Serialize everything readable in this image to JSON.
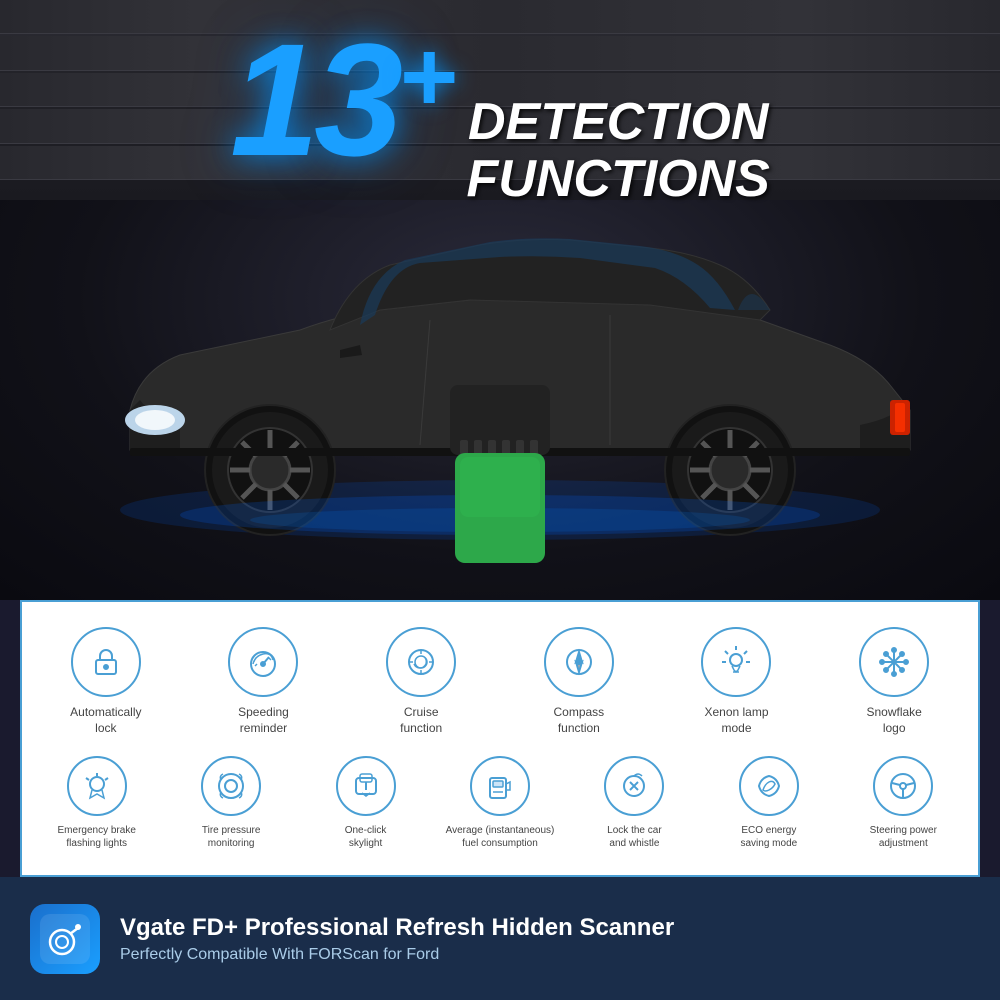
{
  "header": {
    "number": "13",
    "plus": "+",
    "line1": "DETECTION",
    "line2": "FUNCTIONS"
  },
  "features": {
    "row1": [
      {
        "id": "auto-lock",
        "icon": "lock",
        "label": "Automatically\nlock"
      },
      {
        "id": "speeding",
        "icon": "speedometer",
        "label": "Speeding\nreminder"
      },
      {
        "id": "cruise",
        "icon": "cruise",
        "label": "Cruise\nfunction"
      },
      {
        "id": "compass",
        "icon": "compass",
        "label": "Compass\nfunction"
      },
      {
        "id": "xenon",
        "icon": "bulb",
        "label": "Xenon lamp\nmode"
      },
      {
        "id": "snowflake",
        "icon": "snowflake",
        "label": "Snowflake\nlogo"
      }
    ],
    "row2": [
      {
        "id": "emergency",
        "icon": "flash",
        "label": "Emergency brake\nflashing lights"
      },
      {
        "id": "tire",
        "icon": "tire",
        "label": "Tire pressure\nmonitoring"
      },
      {
        "id": "skylight",
        "icon": "skylight",
        "label": "One-click\nskylight"
      },
      {
        "id": "fuel",
        "icon": "fuel",
        "label": "Average (instantaneous)\nfuel consumption"
      },
      {
        "id": "whistle",
        "icon": "whistle",
        "label": "Lock the car\nand whistle"
      },
      {
        "id": "eco",
        "icon": "eco",
        "label": "ECO energy\nsaving mode"
      },
      {
        "id": "steering",
        "icon": "steering",
        "label": "Steering power\nadjustment"
      }
    ]
  },
  "app": {
    "title": "Vgate FD+ Professional Refresh Hidden Scanner",
    "subtitle": "Perfectly Compatible With FORScan for Ford"
  }
}
